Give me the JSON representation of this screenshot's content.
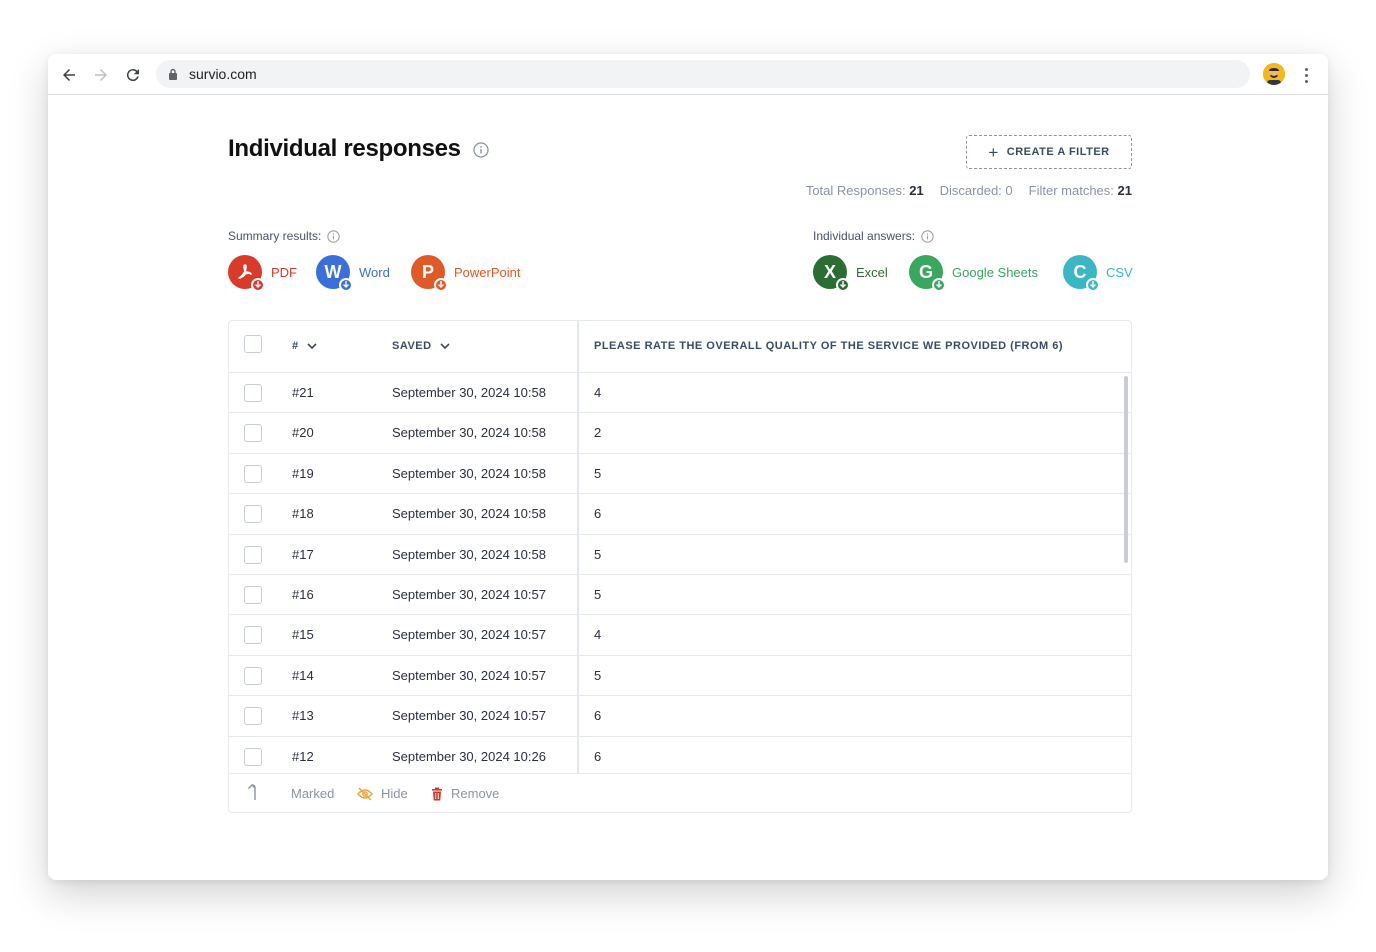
{
  "browser": {
    "url": "survio.com"
  },
  "page": {
    "title": "Individual responses",
    "filter_button": "CREATE A FILTER",
    "stats": {
      "total_label": "Total Responses:",
      "total_value": "21",
      "discarded_label": "Discarded:",
      "discarded_value": "0",
      "matches_label": "Filter matches:",
      "matches_value": "21"
    }
  },
  "summary": {
    "label": "Summary results:",
    "items": [
      {
        "label": "PDF",
        "color": "#d93b2b"
      },
      {
        "label": "Word",
        "color": "#3b6fd9"
      },
      {
        "label": "PowerPoint",
        "color": "#e05a28"
      }
    ]
  },
  "individual": {
    "label": "Individual answers:",
    "items": [
      {
        "label": "Excel",
        "color": "#2b6e33"
      },
      {
        "label": "Google Sheets",
        "color": "#37a85e"
      },
      {
        "label": "CSV",
        "color": "#3ab6c4"
      }
    ]
  },
  "table": {
    "columns": [
      "#",
      "SAVED",
      "PLEASE RATE THE OVERALL QUALITY OF THE SERVICE WE PROVIDED (FROM 6)"
    ],
    "rows": [
      {
        "id": "#21",
        "saved": "September 30, 2024 10:58",
        "rating": "4"
      },
      {
        "id": "#20",
        "saved": "September 30, 2024 10:58",
        "rating": "2"
      },
      {
        "id": "#19",
        "saved": "September 30, 2024 10:58",
        "rating": "5"
      },
      {
        "id": "#18",
        "saved": "September 30, 2024 10:58",
        "rating": "6"
      },
      {
        "id": "#17",
        "saved": "September 30, 2024 10:58",
        "rating": "5"
      },
      {
        "id": "#16",
        "saved": "September 30, 2024 10:57",
        "rating": "5"
      },
      {
        "id": "#15",
        "saved": "September 30, 2024 10:57",
        "rating": "4"
      },
      {
        "id": "#14",
        "saved": "September 30, 2024 10:57",
        "rating": "5"
      },
      {
        "id": "#13",
        "saved": "September 30, 2024 10:57",
        "rating": "6"
      },
      {
        "id": "#12",
        "saved": "September 30, 2024 10:26",
        "rating": "6"
      }
    ],
    "footer": {
      "marked": "Marked",
      "hide": "Hide",
      "remove": "Remove"
    }
  }
}
